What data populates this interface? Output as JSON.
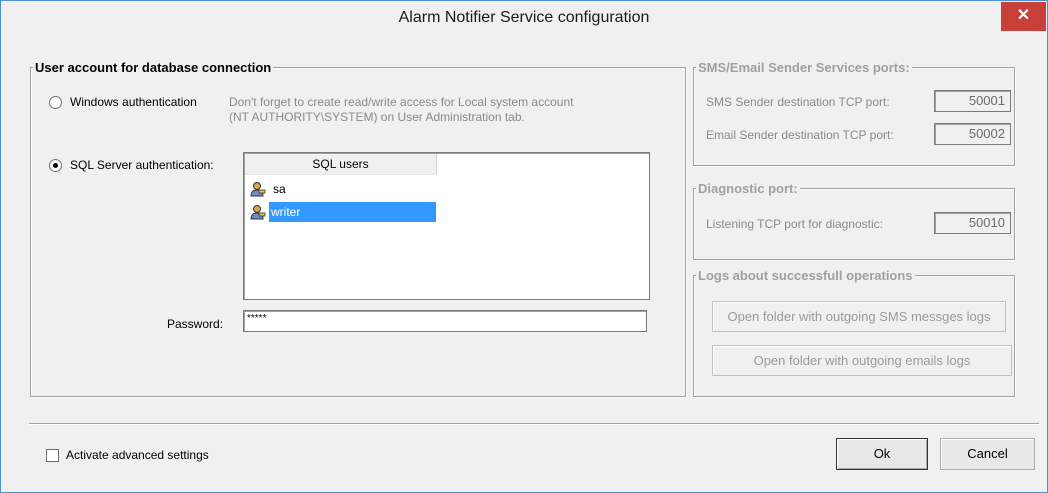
{
  "window": {
    "title": "Alarm Notifier Service configuration",
    "close_symbol": "✕"
  },
  "db_group": {
    "legend": "User account for database connection",
    "windows_auth_label": "Windows authentication",
    "windows_auth_hint_line1": "Don't forget to create read/write access for Local system account",
    "windows_auth_hint_line2": "(NT AUTHORITY\\SYSTEM) on User Administration tab.",
    "sql_auth_label": "SQL Server authentication:",
    "sql_users_header": "SQL users",
    "sql_users": [
      {
        "name": "sa",
        "selected": false,
        "icon": "user-key-icon"
      },
      {
        "name": "writer",
        "selected": true,
        "icon": "user-key-icon"
      }
    ],
    "password_label": "Password:",
    "password_value": "*****",
    "selected_auth": "sql"
  },
  "ports_group": {
    "legend": "SMS/Email Sender Services ports:",
    "sms_port_label": "SMS Sender destination TCP port:",
    "sms_port_value": "50001",
    "email_port_label": "Email Sender destination TCP port:",
    "email_port_value": "50002"
  },
  "diag_group": {
    "legend": "Diagnostic port:",
    "diag_port_label": "Listening TCP port for diagnostic:",
    "diag_port_value": "50010"
  },
  "logs_group": {
    "legend": "Logs about successfull operations",
    "sms_logs_button": "Open folder with outgoing SMS messges logs",
    "email_logs_button": "Open folder with outgoing emails logs"
  },
  "footer": {
    "advanced_label": "Activate advanced settings",
    "advanced_checked": false,
    "ok_label": "Ok",
    "cancel_label": "Cancel"
  },
  "colors": {
    "selection": "#3399ff",
    "close_button": "#c7413a",
    "window_border": "#4a8fd8"
  }
}
